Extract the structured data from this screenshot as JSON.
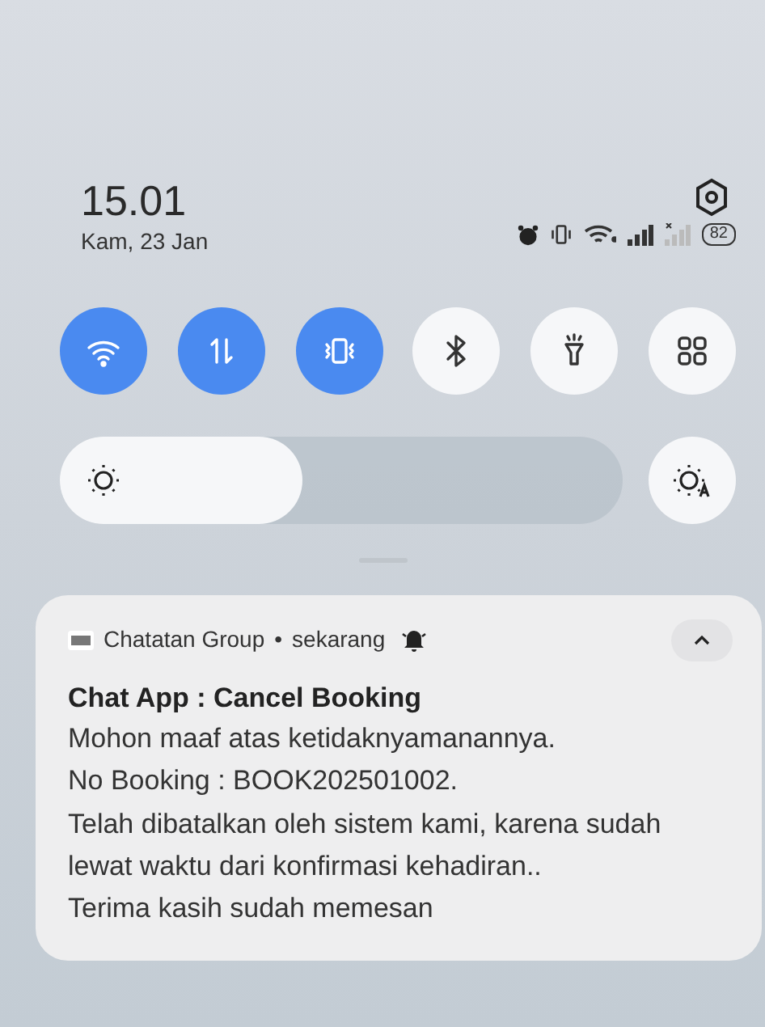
{
  "status_bar": {
    "battery": "82",
    "icons": [
      {
        "kind": "alarm"
      },
      {
        "kind": "vibrate"
      },
      {
        "kind": "wifi"
      },
      {
        "kind": "signal"
      },
      {
        "kind": "signal-off"
      }
    ]
  },
  "clock": {
    "time": "15.01",
    "date": "Kam, 23 Jan"
  },
  "toggles": [
    {
      "kind": "wifi",
      "on": true
    },
    {
      "kind": "data",
      "on": true
    },
    {
      "kind": "vibrate",
      "on": true
    },
    {
      "kind": "bluetooth",
      "on": false
    },
    {
      "kind": "flashlight",
      "on": false
    },
    {
      "kind": "grid",
      "on": false
    }
  ],
  "brightness": {
    "level": 0.43
  },
  "notification": {
    "app": "Chatatan Group",
    "separator": "•",
    "time": "sekarang",
    "title": "Chat App : Cancel Booking",
    "body_lines": [
      "Mohon maaf atas ketidaknyamanannya.",
      "No Booking : BOOK202501002.",
      "Telah dibatalkan oleh sistem kami, karena sudah lewat waktu dari konfirmasi kehadiran..",
      "Terima kasih sudah memesan"
    ]
  }
}
